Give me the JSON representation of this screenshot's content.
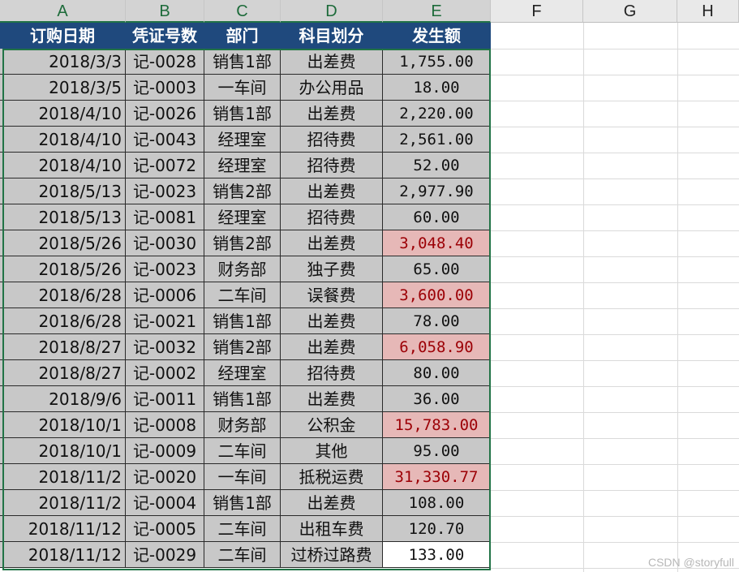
{
  "columns": [
    "A",
    "B",
    "C",
    "D",
    "E",
    "F",
    "G",
    "H"
  ],
  "headers": [
    "订购日期",
    "凭证号数",
    "部门",
    "科目划分",
    "发生额"
  ],
  "rows": [
    {
      "date": "2018/3/3",
      "voucher": "记-0028",
      "dept": "销售1部",
      "subject": "出差费",
      "amount": "1,755.00",
      "highlight": false
    },
    {
      "date": "2018/3/5",
      "voucher": "记-0003",
      "dept": "一车间",
      "subject": "办公用品",
      "amount": "18.00",
      "highlight": false
    },
    {
      "date": "2018/4/10",
      "voucher": "记-0026",
      "dept": "销售1部",
      "subject": "出差费",
      "amount": "2,220.00",
      "highlight": false
    },
    {
      "date": "2018/4/10",
      "voucher": "记-0043",
      "dept": "经理室",
      "subject": "招待费",
      "amount": "2,561.00",
      "highlight": false
    },
    {
      "date": "2018/4/10",
      "voucher": "记-0072",
      "dept": "经理室",
      "subject": "招待费",
      "amount": "52.00",
      "highlight": false
    },
    {
      "date": "2018/5/13",
      "voucher": "记-0023",
      "dept": "销售2部",
      "subject": "出差费",
      "amount": "2,977.90",
      "highlight": false
    },
    {
      "date": "2018/5/13",
      "voucher": "记-0081",
      "dept": "经理室",
      "subject": "招待费",
      "amount": "60.00",
      "highlight": false
    },
    {
      "date": "2018/5/26",
      "voucher": "记-0030",
      "dept": "销售2部",
      "subject": "出差费",
      "amount": "3,048.40",
      "highlight": true
    },
    {
      "date": "2018/5/26",
      "voucher": "记-0023",
      "dept": "财务部",
      "subject": "独子费",
      "amount": "65.00",
      "highlight": false
    },
    {
      "date": "2018/6/28",
      "voucher": "记-0006",
      "dept": "二车间",
      "subject": "误餐费",
      "amount": "3,600.00",
      "highlight": true
    },
    {
      "date": "2018/6/28",
      "voucher": "记-0021",
      "dept": "销售1部",
      "subject": "出差费",
      "amount": "78.00",
      "highlight": false
    },
    {
      "date": "2018/8/27",
      "voucher": "记-0032",
      "dept": "销售2部",
      "subject": "出差费",
      "amount": "6,058.90",
      "highlight": true
    },
    {
      "date": "2018/8/27",
      "voucher": "记-0002",
      "dept": "经理室",
      "subject": "招待费",
      "amount": "80.00",
      "highlight": false
    },
    {
      "date": "2018/9/6",
      "voucher": "记-0011",
      "dept": "销售1部",
      "subject": "出差费",
      "amount": "36.00",
      "highlight": false
    },
    {
      "date": "2018/10/1",
      "voucher": "记-0008",
      "dept": "财务部",
      "subject": "公积金",
      "amount": "15,783.00",
      "highlight": true
    },
    {
      "date": "2018/10/1",
      "voucher": "记-0009",
      "dept": "二车间",
      "subject": "其他",
      "amount": "95.00",
      "highlight": false
    },
    {
      "date": "2018/11/2",
      "voucher": "记-0020",
      "dept": "一车间",
      "subject": "抵税运费",
      "amount": "31,330.77",
      "highlight": true
    },
    {
      "date": "2018/11/2",
      "voucher": "记-0004",
      "dept": "销售1部",
      "subject": "出差费",
      "amount": "108.00",
      "highlight": false
    },
    {
      "date": "2018/11/12",
      "voucher": "记-0005",
      "dept": "二车间",
      "subject": "出租车费",
      "amount": "120.70",
      "highlight": false
    },
    {
      "date": "2018/11/12",
      "voucher": "记-0029",
      "dept": "二车间",
      "subject": "过桥过路费",
      "amount": "133.00",
      "highlight": false,
      "white": true
    }
  ],
  "colors": {
    "header_bg": "#1f497d",
    "data_bg": "#c8c8c8",
    "highlight_bg": "#e6b8b7",
    "highlight_text": "#9c0006",
    "selection": "#217346"
  },
  "watermark": "CSDN @storyfull"
}
